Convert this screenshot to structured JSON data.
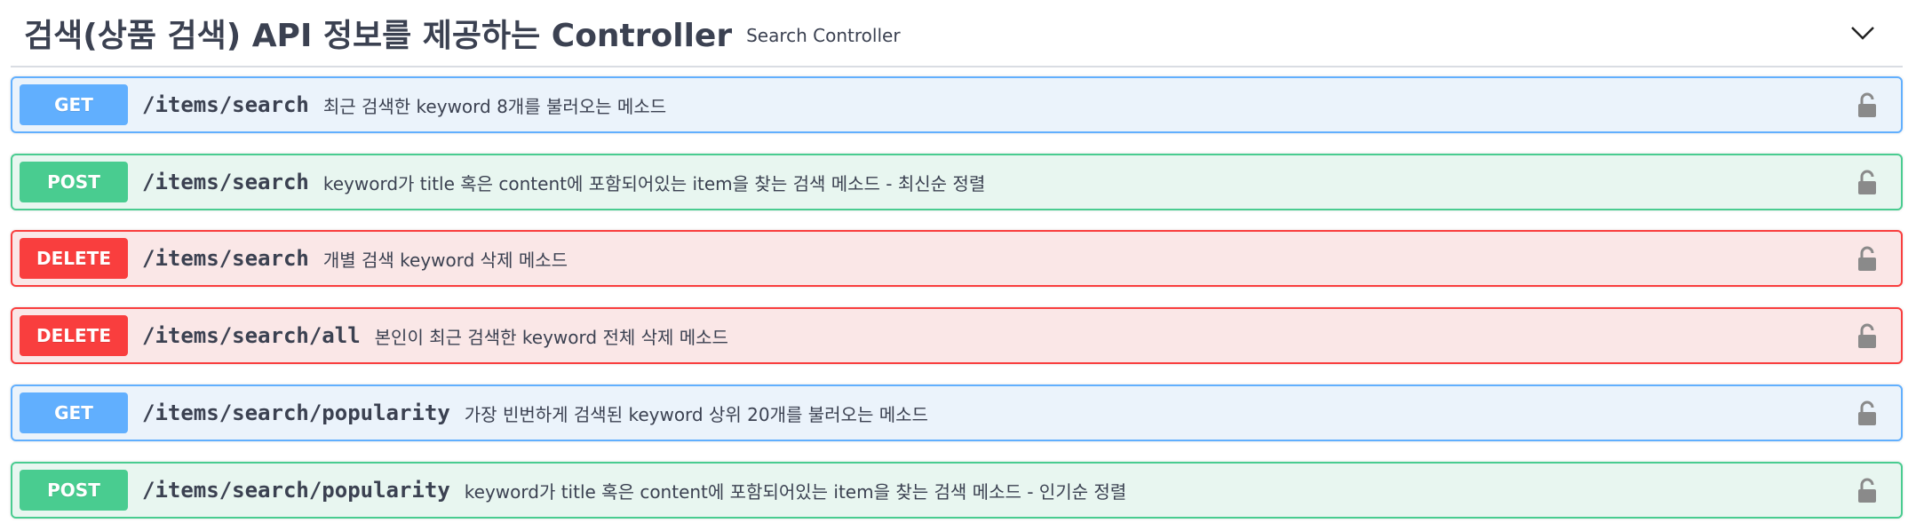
{
  "tag": {
    "title": "검색(상품 검색) API 정보를 제공하는 Controller",
    "description": "Search Controller"
  },
  "operations": [
    {
      "method": "GET",
      "path": "/items/search",
      "summary": "최근 검색한 keyword 8개를 불러오는 메소드"
    },
    {
      "method": "POST",
      "path": "/items/search",
      "summary": "keyword가 title 혹은 content에 포함되어있는 item을 찾는 검색 메소드 - 최신순 정렬"
    },
    {
      "method": "DELETE",
      "path": "/items/search",
      "summary": "개별 검색 keyword 삭제 메소드"
    },
    {
      "method": "DELETE",
      "path": "/items/search/all",
      "summary": "본인이 최근 검색한 keyword 전체 삭제 메소드"
    },
    {
      "method": "GET",
      "path": "/items/search/popularity",
      "summary": "가장 빈번하게 검색된 keyword 상위 20개를 불러오는 메소드"
    },
    {
      "method": "POST",
      "path": "/items/search/popularity",
      "summary": "keyword가 title 혹은 content에 포함되어있는 item을 찾는 검색 메소드 - 인기순 정렬"
    }
  ],
  "colors": {
    "get": "#61affe",
    "post": "#49cc90",
    "delete": "#f93e3e",
    "lock": "#8a8a8a"
  },
  "icons": {
    "collapse": "chevron-down-icon",
    "auth": "lock-icon"
  }
}
